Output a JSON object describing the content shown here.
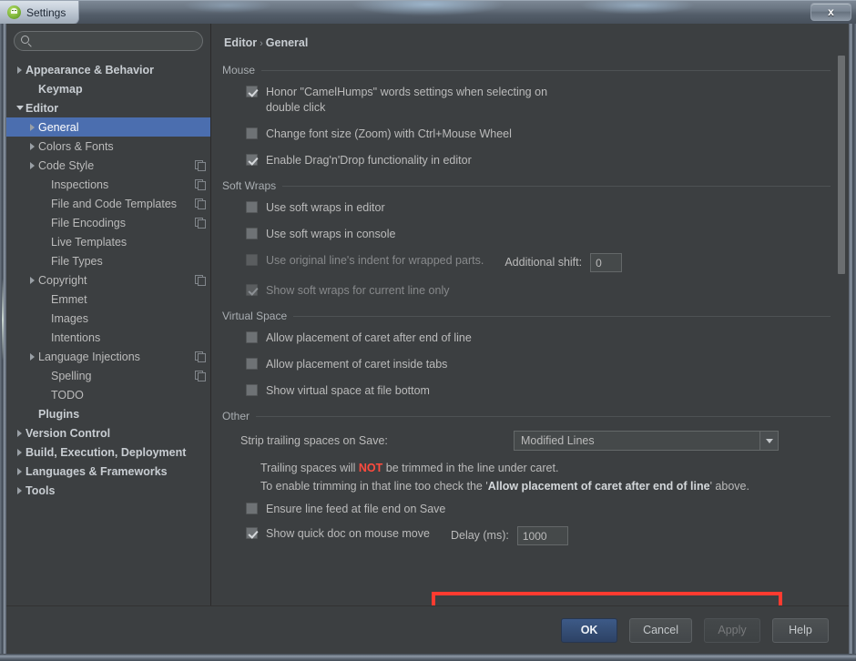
{
  "window": {
    "title": "Settings",
    "app_icon": "android-studio-icon",
    "close_label": "x"
  },
  "sidebar": {
    "search": {
      "value": "",
      "placeholder": ""
    },
    "items": [
      {
        "label": "Appearance & Behavior",
        "indent": 0,
        "twisty": "right",
        "bold": true,
        "copy": false,
        "selected": false
      },
      {
        "label": "Keymap",
        "indent": 1,
        "twisty": "none",
        "bold": true,
        "copy": false,
        "selected": false
      },
      {
        "label": "Editor",
        "indent": 0,
        "twisty": "down",
        "bold": true,
        "copy": false,
        "selected": false
      },
      {
        "label": "General",
        "indent": 1,
        "twisty": "right",
        "bold": false,
        "copy": false,
        "selected": true
      },
      {
        "label": "Colors & Fonts",
        "indent": 1,
        "twisty": "right",
        "bold": false,
        "copy": false,
        "selected": false
      },
      {
        "label": "Code Style",
        "indent": 1,
        "twisty": "right",
        "bold": false,
        "copy": true,
        "selected": false
      },
      {
        "label": "Inspections",
        "indent": 2,
        "twisty": "none",
        "bold": false,
        "copy": true,
        "selected": false
      },
      {
        "label": "File and Code Templates",
        "indent": 2,
        "twisty": "none",
        "bold": false,
        "copy": true,
        "selected": false
      },
      {
        "label": "File Encodings",
        "indent": 2,
        "twisty": "none",
        "bold": false,
        "copy": true,
        "selected": false
      },
      {
        "label": "Live Templates",
        "indent": 2,
        "twisty": "none",
        "bold": false,
        "copy": false,
        "selected": false
      },
      {
        "label": "File Types",
        "indent": 2,
        "twisty": "none",
        "bold": false,
        "copy": false,
        "selected": false
      },
      {
        "label": "Copyright",
        "indent": 1,
        "twisty": "right",
        "bold": false,
        "copy": true,
        "selected": false
      },
      {
        "label": "Emmet",
        "indent": 2,
        "twisty": "none",
        "bold": false,
        "copy": false,
        "selected": false
      },
      {
        "label": "Images",
        "indent": 2,
        "twisty": "none",
        "bold": false,
        "copy": false,
        "selected": false
      },
      {
        "label": "Intentions",
        "indent": 2,
        "twisty": "none",
        "bold": false,
        "copy": false,
        "selected": false
      },
      {
        "label": "Language Injections",
        "indent": 1,
        "twisty": "right",
        "bold": false,
        "copy": true,
        "selected": false
      },
      {
        "label": "Spelling",
        "indent": 2,
        "twisty": "none",
        "bold": false,
        "copy": true,
        "selected": false
      },
      {
        "label": "TODO",
        "indent": 2,
        "twisty": "none",
        "bold": false,
        "copy": false,
        "selected": false
      },
      {
        "label": "Plugins",
        "indent": 1,
        "twisty": "none",
        "bold": true,
        "copy": false,
        "selected": false
      },
      {
        "label": "Version Control",
        "indent": 0,
        "twisty": "right",
        "bold": true,
        "copy": false,
        "selected": false
      },
      {
        "label": "Build, Execution, Deployment",
        "indent": 0,
        "twisty": "right",
        "bold": true,
        "copy": false,
        "selected": false
      },
      {
        "label": "Languages & Frameworks",
        "indent": 0,
        "twisty": "right",
        "bold": true,
        "copy": false,
        "selected": false
      },
      {
        "label": "Tools",
        "indent": 0,
        "twisty": "right",
        "bold": true,
        "copy": false,
        "selected": false
      }
    ]
  },
  "content": {
    "breadcrumb": {
      "parent": "Editor",
      "separator": "›",
      "current": "General"
    },
    "groups": {
      "mouse": {
        "title": "Mouse",
        "options": [
          {
            "label": "Honor \"CamelHumps\" words settings when selecting on double click",
            "checked": true,
            "disabled": false
          },
          {
            "label": "Change font size (Zoom) with Ctrl+Mouse Wheel",
            "checked": false,
            "disabled": false
          },
          {
            "label": "Enable Drag'n'Drop functionality in editor",
            "checked": true,
            "disabled": false
          }
        ]
      },
      "soft_wraps": {
        "title": "Soft Wraps",
        "options": [
          {
            "label": "Use soft wraps in editor",
            "checked": false,
            "disabled": false
          },
          {
            "label": "Use soft wraps in console",
            "checked": false,
            "disabled": false
          },
          {
            "label": "Use original line's indent for wrapped parts.",
            "checked": false,
            "disabled": true
          },
          {
            "label": "Show soft wraps for current line only",
            "checked": true,
            "disabled": true
          }
        ],
        "additional_shift_label": "Additional shift:",
        "additional_shift_value": "0"
      },
      "virtual_space": {
        "title": "Virtual Space",
        "options": [
          {
            "label": "Allow placement of caret after end of line",
            "checked": false,
            "disabled": false
          },
          {
            "label": "Allow placement of caret inside tabs",
            "checked": false,
            "disabled": false
          },
          {
            "label": "Show virtual space at file bottom",
            "checked": false,
            "disabled": false
          }
        ]
      },
      "other": {
        "title": "Other",
        "strip_label": "Strip trailing spaces on Save:",
        "strip_value": "Modified Lines",
        "note_line1_pre": "Trailing spaces will ",
        "note_line1_not": "NOT",
        "note_line1_post": " be trimmed in the line under caret.",
        "note_line2_pre": "To enable trimming in that line too check the '",
        "note_line2_bold": "Allow placement of caret after end of line",
        "note_line2_post": "' above.",
        "ensure_linefeed_label": "Ensure line feed at file end on Save",
        "ensure_linefeed_checked": false,
        "quick_doc_label": "Show quick doc on mouse move",
        "quick_doc_checked": true,
        "delay_label": "Delay (ms):",
        "delay_value": "1000"
      }
    }
  },
  "footer": {
    "ok": "OK",
    "cancel": "Cancel",
    "apply": "Apply",
    "help": "Help"
  },
  "colors": {
    "selection": "#4b6eaf",
    "highlight_box": "#ff3b30",
    "warning_text": "#ff4b3e",
    "panel_bg": "#3c3f41"
  }
}
